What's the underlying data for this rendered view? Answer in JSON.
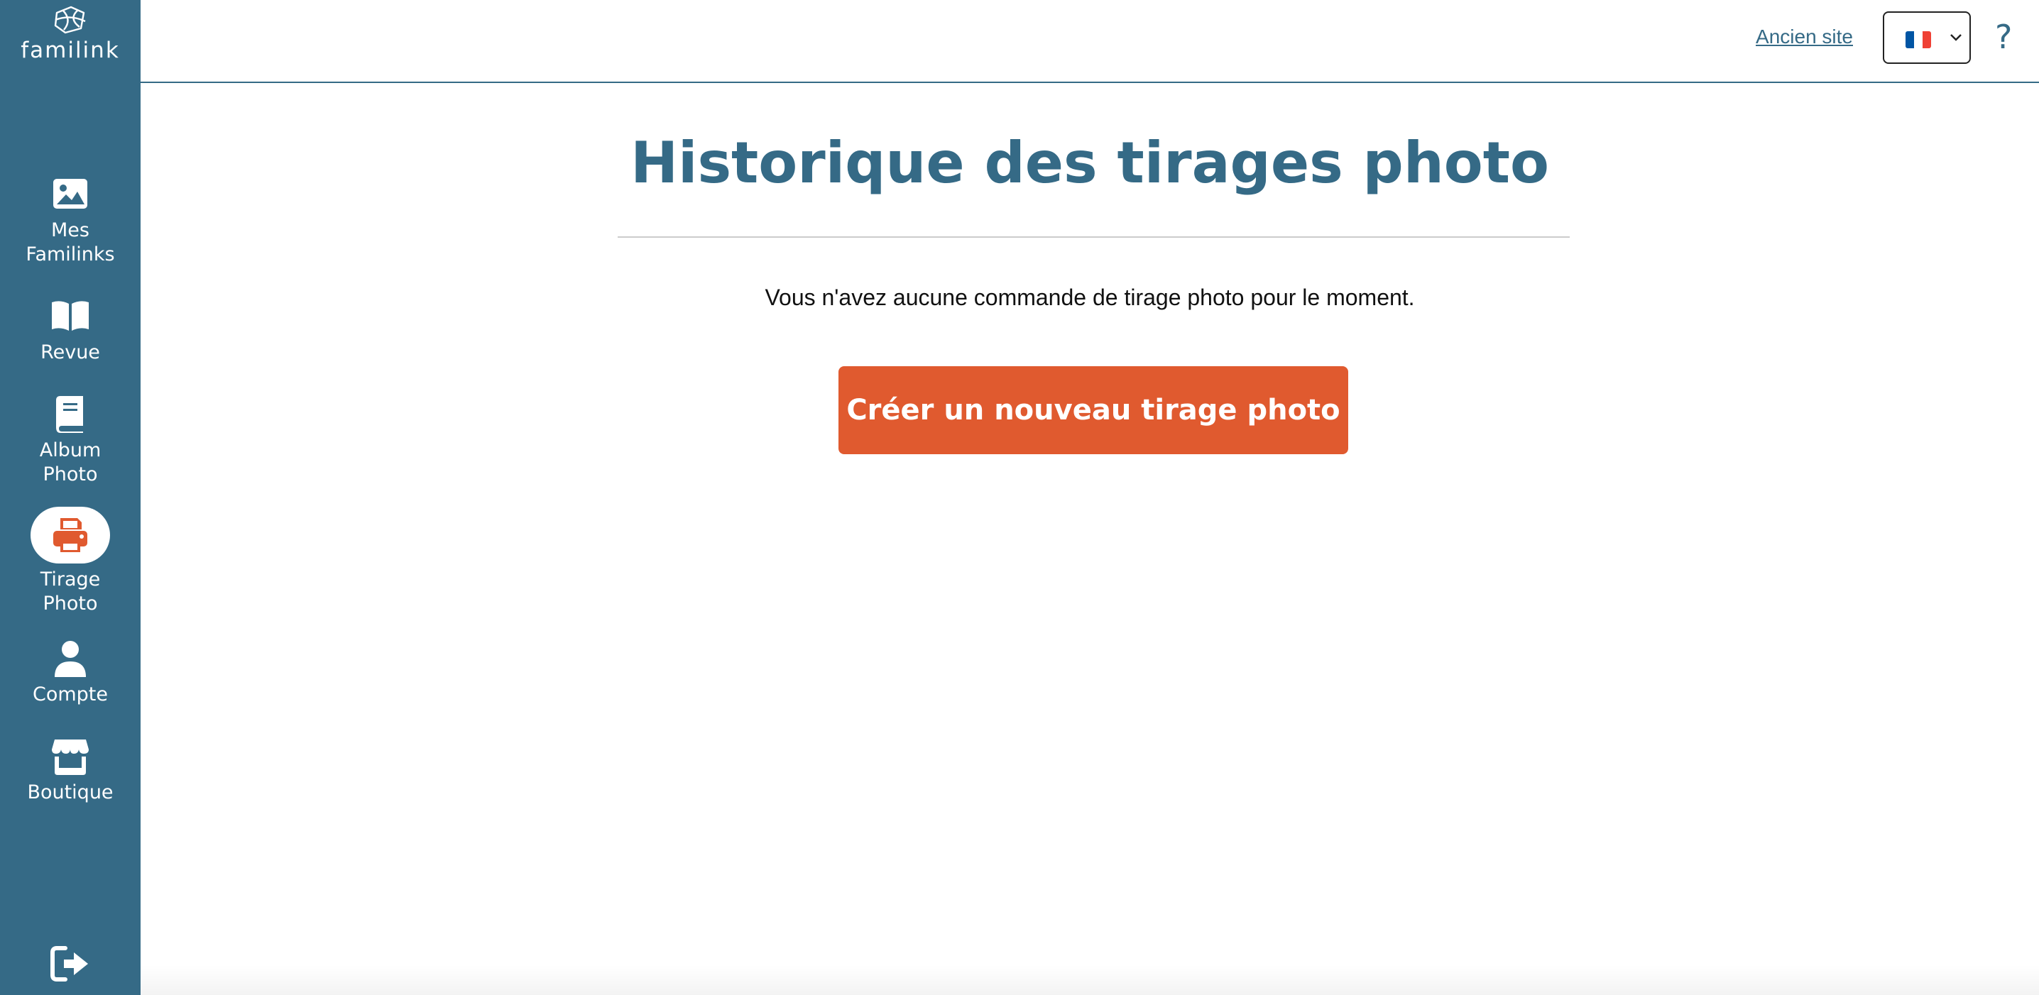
{
  "sidebar": {
    "logo_text": "familink",
    "items": [
      {
        "label": "Mes\nFamilinks",
        "icon": "image-icon"
      },
      {
        "label": "Revue",
        "icon": "book-open-icon"
      },
      {
        "label": "Album\nPhoto",
        "icon": "book-icon"
      },
      {
        "label": "Tirage\nPhoto",
        "icon": "printer-icon",
        "active": true
      },
      {
        "label": "Compte",
        "icon": "user-icon"
      },
      {
        "label": "Boutique",
        "icon": "store-icon"
      }
    ],
    "logout_icon": "logout-icon"
  },
  "header": {
    "old_site_link": "Ancien site",
    "language": {
      "selected": "fr",
      "flag_colors": [
        "#0055a4",
        "#ffffff",
        "#ef4135"
      ]
    },
    "help": "?"
  },
  "main": {
    "title": "Historique des tirages photo",
    "empty_message": "Vous n'avez aucune commande de tirage photo pour le moment.",
    "create_button": "Créer un nouveau tirage photo"
  },
  "colors": {
    "sidebar_bg": "#356a86",
    "accent": "#e05a2f",
    "title": "#356a86"
  }
}
